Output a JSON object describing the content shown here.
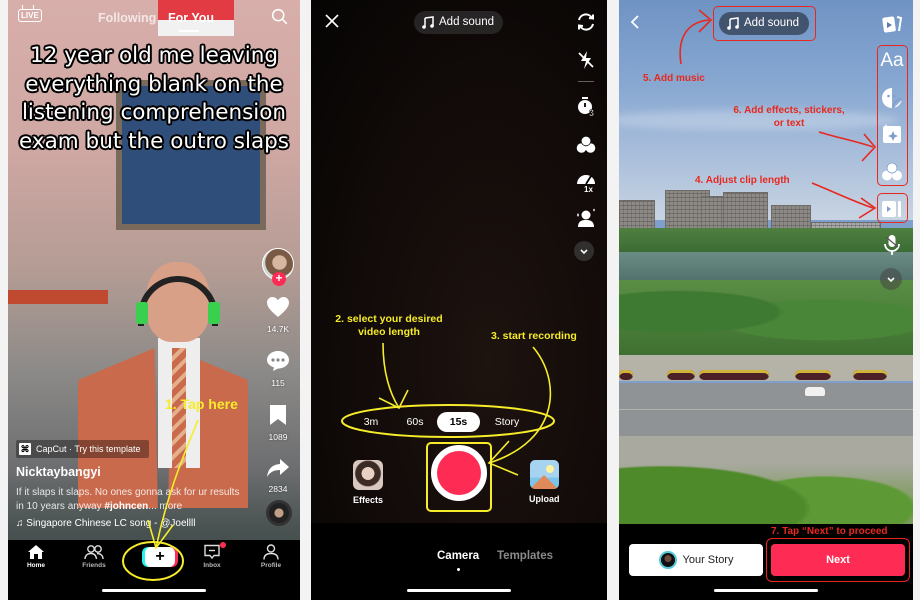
{
  "panel_feed": {
    "top_tabs": {
      "live_label": "LIVE",
      "following": "Following",
      "for_you": "For You"
    },
    "caption_overlay": [
      "12 year old me leaving",
      "everything blank on the",
      "listening comprehension",
      "exam but the outro slaps"
    ],
    "rail": {
      "likes": "14.7K",
      "comments": "115",
      "saves": "1089",
      "shares": "2834"
    },
    "template_badge": "CapCut · Try this template",
    "username": "Nicktaybangyi",
    "description_plain": "If it slaps it slaps. No ones gonna ask for ur results in 10 years anyway ",
    "description_hashtag": "#johncen",
    "description_more": "... more",
    "music": "♫ Singapore Chinese LC song - @Joellll",
    "nav": [
      {
        "label": "Home",
        "icon": "home-icon",
        "active": true
      },
      {
        "label": "Friends",
        "icon": "friends-icon",
        "active": false
      },
      {
        "label": "",
        "icon": "create-plus-icon",
        "active": false
      },
      {
        "label": "Inbox",
        "icon": "inbox-icon",
        "active": false,
        "badge": true
      },
      {
        "label": "Profile",
        "icon": "profile-icon",
        "active": false
      }
    ],
    "create_symbol": "+",
    "annotation": "1. Tap here"
  },
  "panel_camera": {
    "add_sound": "Add sound",
    "rail_icons": [
      "flip-camera-icon",
      "flash-off-icon",
      "timer-icon",
      "filters-icon",
      "speed-icon",
      "beautify-icon",
      "chevron-down-icon"
    ],
    "timer_badge": "3",
    "speed_badge": "1x",
    "lengths": [
      "3m",
      "60s",
      "15s",
      "Story"
    ],
    "selected_length": "15s",
    "effects_label": "Effects",
    "upload_label": "Upload",
    "modes": [
      "Camera",
      "Templates"
    ],
    "active_mode": "Camera",
    "annotation_length": [
      "2. select your desired",
      "video length"
    ],
    "annotation_record": "3. start recording"
  },
  "panel_editor": {
    "add_sound": "Add sound",
    "rail_icons": [
      "templates-icon",
      "text-icon",
      "sticker-icon",
      "effects-icon",
      "filters-icon",
      "clip-length-icon",
      "voiceover-icon",
      "chevron-down-icon"
    ],
    "text_tool_label": "Aa",
    "your_story": "Your Story",
    "next": "Next",
    "annotation_music": "5. Add music",
    "annotation_effects": [
      "6. Add effects, stickers,",
      "or text"
    ],
    "annotation_clip": "4.  Adjust clip length",
    "annotation_next": "7. Tap “Next” to proceed"
  },
  "colors": {
    "brand_red": "#fe2c55",
    "brand_cyan": "#25f4ee",
    "annotation_yellow": "#f6ec2a",
    "annotation_red": "#e8281e"
  }
}
